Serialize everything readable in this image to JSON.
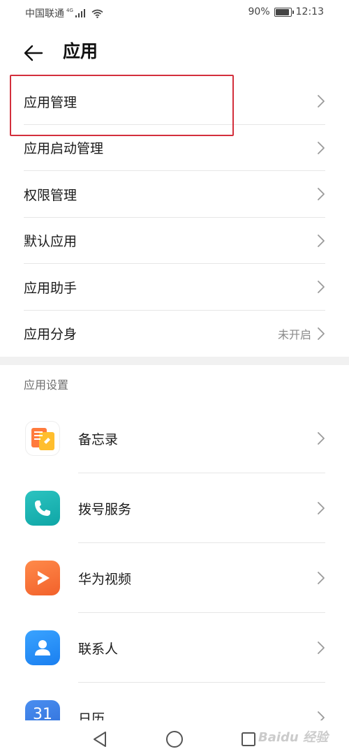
{
  "status_bar": {
    "carrier": "中国联通",
    "network": "4G",
    "battery": "90%",
    "battery_level": 0.9,
    "time": "12:13"
  },
  "header": {
    "title": "应用"
  },
  "menu": {
    "items": [
      {
        "label": "应用管理",
        "value": ""
      },
      {
        "label": "应用启动管理",
        "value": ""
      },
      {
        "label": "权限管理",
        "value": ""
      },
      {
        "label": "默认应用",
        "value": ""
      },
      {
        "label": "应用助手",
        "value": ""
      },
      {
        "label": "应用分身",
        "value": "未开启"
      }
    ]
  },
  "app_settings": {
    "section_title": "应用设置",
    "apps": [
      {
        "label": "备忘录",
        "icon": "memo-icon"
      },
      {
        "label": "拨号服务",
        "icon": "phone-icon"
      },
      {
        "label": "华为视频",
        "icon": "video-play-icon"
      },
      {
        "label": "联系人",
        "icon": "contact-person-icon"
      },
      {
        "label": "日历",
        "icon": "calendar-icon",
        "icon_text": "31"
      }
    ]
  },
  "highlight_color": "#d32f3c",
  "watermark": "Baidu 经验"
}
